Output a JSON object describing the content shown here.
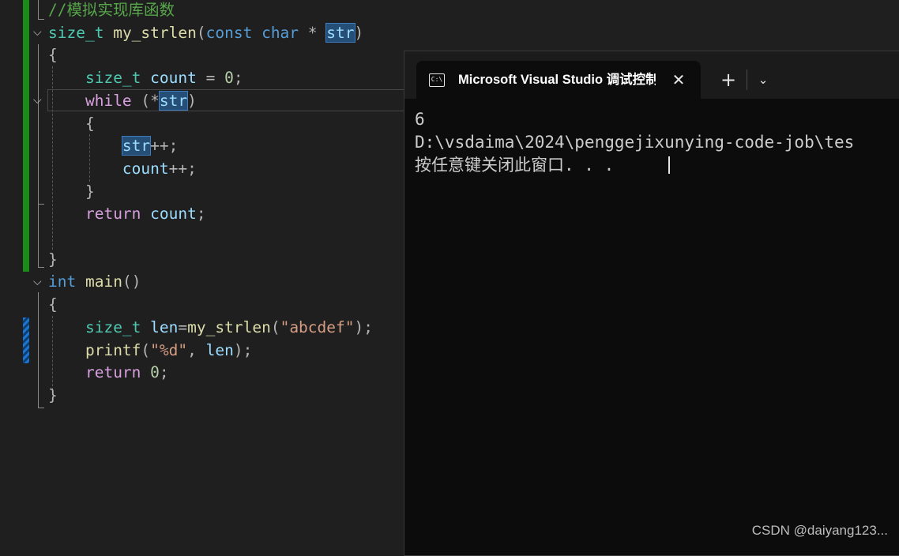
{
  "editor": {
    "lines": [
      {
        "tokens": [
          {
            "t": "//模拟实现库函数",
            "c": "comment"
          }
        ]
      },
      {
        "tokens": [
          {
            "t": "size_t",
            "c": "type"
          },
          {
            "t": " ",
            "c": "punc"
          },
          {
            "t": "my_strlen",
            "c": "func"
          },
          {
            "t": "(",
            "c": "punc"
          },
          {
            "t": "const",
            "c": "kw"
          },
          {
            "t": " ",
            "c": "punc"
          },
          {
            "t": "char",
            "c": "kw"
          },
          {
            "t": " * ",
            "c": "punc"
          },
          {
            "t": "str",
            "c": "var hl"
          },
          {
            "t": ")",
            "c": "punc"
          }
        ]
      },
      {
        "tokens": [
          {
            "t": "{",
            "c": "punc"
          }
        ]
      },
      {
        "tokens": [
          {
            "t": "    ",
            "c": "punc"
          },
          {
            "t": "size_t",
            "c": "type"
          },
          {
            "t": " ",
            "c": "punc"
          },
          {
            "t": "count",
            "c": "var"
          },
          {
            "t": " = ",
            "c": "punc"
          },
          {
            "t": "0",
            "c": "num"
          },
          {
            "t": ";",
            "c": "punc"
          }
        ]
      },
      {
        "tokens": [
          {
            "t": "    ",
            "c": "punc"
          },
          {
            "t": "while",
            "c": "ctrl"
          },
          {
            "t": " (*",
            "c": "punc"
          },
          {
            "t": "str",
            "c": "var hl"
          },
          {
            "t": ")",
            "c": "punc"
          }
        ]
      },
      {
        "tokens": [
          {
            "t": "    {",
            "c": "punc"
          }
        ]
      },
      {
        "tokens": [
          {
            "t": "        ",
            "c": "punc"
          },
          {
            "t": "str",
            "c": "var hl"
          },
          {
            "t": "++;",
            "c": "punc"
          }
        ]
      },
      {
        "tokens": [
          {
            "t": "        ",
            "c": "punc"
          },
          {
            "t": "count",
            "c": "var"
          },
          {
            "t": "++;",
            "c": "punc"
          }
        ]
      },
      {
        "tokens": [
          {
            "t": "    }",
            "c": "punc"
          }
        ]
      },
      {
        "tokens": [
          {
            "t": "    ",
            "c": "punc"
          },
          {
            "t": "return",
            "c": "ctrl"
          },
          {
            "t": " ",
            "c": "punc"
          },
          {
            "t": "count",
            "c": "var"
          },
          {
            "t": ";",
            "c": "punc"
          }
        ]
      },
      {
        "tokens": []
      },
      {
        "tokens": [
          {
            "t": "}",
            "c": "punc"
          }
        ]
      },
      {
        "tokens": [
          {
            "t": "int",
            "c": "kw"
          },
          {
            "t": " ",
            "c": "punc"
          },
          {
            "t": "main",
            "c": "func"
          },
          {
            "t": "()",
            "c": "punc"
          }
        ]
      },
      {
        "tokens": [
          {
            "t": "{",
            "c": "punc"
          }
        ]
      },
      {
        "tokens": [
          {
            "t": "    ",
            "c": "punc"
          },
          {
            "t": "size_t",
            "c": "type"
          },
          {
            "t": " ",
            "c": "punc"
          },
          {
            "t": "len",
            "c": "var"
          },
          {
            "t": "=",
            "c": "punc"
          },
          {
            "t": "my_strlen",
            "c": "func"
          },
          {
            "t": "(",
            "c": "punc"
          },
          {
            "t": "\"abcdef\"",
            "c": "str"
          },
          {
            "t": ");",
            "c": "punc"
          }
        ]
      },
      {
        "tokens": [
          {
            "t": "    ",
            "c": "punc"
          },
          {
            "t": "printf",
            "c": "func"
          },
          {
            "t": "(",
            "c": "punc"
          },
          {
            "t": "\"%d\"",
            "c": "str"
          },
          {
            "t": ", ",
            "c": "punc"
          },
          {
            "t": "len",
            "c": "var"
          },
          {
            "t": ");",
            "c": "punc"
          }
        ]
      },
      {
        "tokens": [
          {
            "t": "    ",
            "c": "punc"
          },
          {
            "t": "return",
            "c": "ctrl"
          },
          {
            "t": " ",
            "c": "punc"
          },
          {
            "t": "0",
            "c": "num"
          },
          {
            "t": ";",
            "c": "punc"
          }
        ]
      },
      {
        "tokens": [
          {
            "t": "}",
            "c": "punc"
          }
        ]
      }
    ]
  },
  "console": {
    "tab_title": "Microsoft Visual Studio 调试控制台",
    "tab_icon": "console-app-icon",
    "tab_icon_text": "C:\\",
    "close_glyph": "✕",
    "new_tab_glyph": "+",
    "dropdown_glyph": "⌄",
    "output": [
      "6",
      "D:\\vsdaima\\2024\\penggejixunying-code-job\\tes",
      "按任意键关闭此窗口. . ."
    ]
  },
  "watermark": "CSDN @daiyang123...",
  "colors": {
    "editor_bg": "#1f1f1f",
    "console_bg": "#0c0c0c",
    "changed_saved": "#1a8c1a",
    "changed_unsaved": "#1b74d1"
  }
}
